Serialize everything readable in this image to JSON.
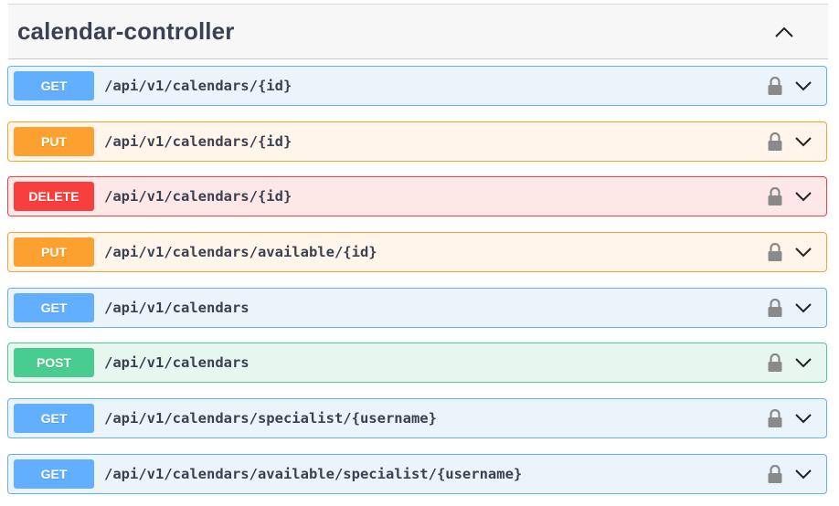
{
  "section": {
    "title": "calendar-controller",
    "collapse_icon": "chevron-up-icon"
  },
  "operations": [
    {
      "method": "GET",
      "path": "/api/v1/calendars/{id}",
      "color": "#61affe"
    },
    {
      "method": "PUT",
      "path": "/api/v1/calendars/{id}",
      "color": "#fca130"
    },
    {
      "method": "DELETE",
      "path": "/api/v1/calendars/{id}",
      "color": "#f93e3e"
    },
    {
      "method": "PUT",
      "path": "/api/v1/calendars/available/{id}",
      "color": "#fca130"
    },
    {
      "method": "GET",
      "path": "/api/v1/calendars",
      "color": "#61affe"
    },
    {
      "method": "POST",
      "path": "/api/v1/calendars",
      "color": "#49cc90"
    },
    {
      "method": "GET",
      "path": "/api/v1/calendars/specialist/{username}",
      "color": "#61affe"
    },
    {
      "method": "GET",
      "path": "/api/v1/calendars/available/specialist/{username}",
      "color": "#61affe"
    }
  ],
  "icons": {
    "lock": "lock-icon",
    "expand": "chevron-down-icon"
  }
}
